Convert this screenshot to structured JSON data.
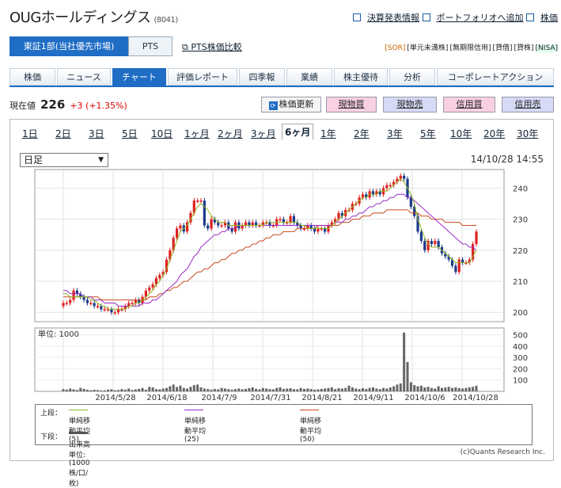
{
  "header": {
    "company": "OUGホールディングス",
    "code": "(8041)",
    "links": [
      "決算発表情報",
      "ポートフォリオへ追加",
      "株価"
    ]
  },
  "market_tabs": {
    "active": "東証1部(当社優先市場)",
    "other": "PTS",
    "compare": "PTS株価比較"
  },
  "badges": [
    "[SOR]",
    "[単元未満株]",
    "[無期限信用]",
    "[貸借]",
    "[貸株]",
    "[NISA]"
  ],
  "nav": [
    {
      "label": "株価"
    },
    {
      "label": "ニュース"
    },
    {
      "label": "チャート"
    },
    {
      "label": "評価レポート"
    },
    {
      "label": "四季報"
    },
    {
      "label": "業績"
    },
    {
      "label": "株主優待"
    },
    {
      "label": "分析"
    },
    {
      "label": "コーポレートアクション"
    }
  ],
  "price": {
    "label": "現在値",
    "value": "226",
    "change": "+3 (+1.35%)"
  },
  "actions": {
    "refresh": "株価更新",
    "buy": "現物買",
    "sell": "現物売",
    "margin_buy": "信用買",
    "margin_sell": "信用売"
  },
  "periods": [
    "1日",
    "2日",
    "3日",
    "5日",
    "10日",
    "1ヶ月",
    "2ヶ月",
    "3ヶ月",
    "6ヶ月",
    "1年",
    "2年",
    "3年",
    "5年",
    "10年",
    "20年",
    "30年"
  ],
  "period_active": "6ヶ月",
  "select": {
    "value": "日足"
  },
  "timestamp": "14/10/28 14:55",
  "legend": {
    "upper_label": "上段：",
    "lower_label": "下段：",
    "ma5": "単純移動平均(5)",
    "ma25": "単純移動平均(25)",
    "ma50": "単純移動平均(50)",
    "volume": "出来高 単位:(1000株/口/枚)"
  },
  "credit": "(c)Quants Research Inc.",
  "colors": {
    "up": "#e02020",
    "down": "#1c3a8c",
    "ma5": "#8cb820",
    "ma25": "#9a2bc4",
    "ma50": "#c84a1c",
    "accent": "#1f6dc5"
  },
  "chart_data": {
    "type": "candlestick",
    "price_axis": {
      "ticks": [
        200,
        210,
        220,
        230,
        240
      ],
      "range": [
        197,
        246
      ]
    },
    "volume_axis": {
      "label": "単位: 1000",
      "ticks": [
        100,
        200,
        300,
        400,
        500
      ],
      "range": [
        0,
        560
      ]
    },
    "x_labels": [
      "2014/5/28",
      "2014/6/18",
      "2014/7/9",
      "2014/7/31",
      "2014/8/21",
      "2014/9/11",
      "2014/10/6",
      "2014/10/28"
    ],
    "close": [
      203,
      203,
      204,
      207,
      206,
      205,
      204,
      203,
      203,
      202,
      202,
      201,
      201,
      201,
      200,
      200,
      201,
      201,
      202,
      203,
      203,
      204,
      203,
      205,
      207,
      208,
      209,
      211,
      212,
      213,
      217,
      220,
      224,
      227,
      228,
      226,
      229,
      232,
      236,
      236,
      236,
      228,
      227,
      230,
      229,
      228,
      228,
      229,
      227,
      226,
      229,
      227,
      228,
      229,
      228,
      229,
      228,
      228,
      229,
      229,
      228,
      228,
      230,
      230,
      229,
      229,
      231,
      229,
      228,
      227,
      227,
      228,
      227,
      226,
      227,
      227,
      226,
      228,
      229,
      230,
      232,
      231,
      233,
      233,
      235,
      235,
      237,
      238,
      237,
      239,
      238,
      239,
      238,
      240,
      241,
      241,
      242,
      243,
      244,
      243,
      237,
      234,
      231,
      226,
      223,
      220,
      223,
      222,
      223,
      221,
      219,
      218,
      217,
      215,
      213,
      217,
      216,
      216,
      217,
      222,
      226
    ],
    "ma5": [
      206,
      206,
      205,
      205,
      205,
      205,
      205,
      205,
      204,
      204,
      203,
      202,
      202,
      201,
      201,
      201,
      201,
      201,
      201,
      202,
      202,
      203,
      203,
      204,
      205,
      206,
      207,
      209,
      210,
      212,
      214,
      217,
      220,
      223,
      226,
      227,
      228,
      230,
      232,
      234,
      235,
      234,
      233,
      231,
      230,
      229,
      229,
      229,
      228,
      228,
      228,
      228,
      228,
      228,
      228,
      228,
      228,
      228,
      228,
      229,
      229,
      229,
      229,
      229,
      229,
      229,
      229,
      229,
      229,
      228,
      228,
      227,
      227,
      227,
      227,
      227,
      227,
      227,
      228,
      229,
      230,
      231,
      232,
      233,
      234,
      235,
      236,
      237,
      237,
      238,
      238,
      238,
      239,
      239,
      239,
      240,
      241,
      242,
      243,
      242,
      240,
      238,
      235,
      230,
      227,
      224,
      222,
      221,
      221,
      221,
      220,
      219,
      218,
      217,
      216,
      216,
      216,
      216,
      216,
      218,
      220
    ],
    "ma25": [
      207,
      207,
      206,
      206,
      206,
      206,
      205,
      205,
      205,
      204,
      204,
      204,
      203,
      203,
      203,
      203,
      202,
      202,
      202,
      202,
      202,
      202,
      202,
      203,
      203,
      203,
      204,
      204,
      205,
      206,
      207,
      208,
      209,
      210,
      212,
      213,
      214,
      216,
      218,
      219,
      221,
      222,
      223,
      224,
      225,
      225,
      226,
      226,
      227,
      227,
      227,
      228,
      228,
      228,
      228,
      228,
      228,
      228,
      228,
      228,
      228,
      228,
      228,
      228,
      228,
      228,
      228,
      228,
      228,
      228,
      228,
      228,
      228,
      228,
      228,
      228,
      228,
      228,
      228,
      229,
      229,
      229,
      230,
      230,
      231,
      231,
      232,
      232,
      233,
      234,
      234,
      235,
      235,
      236,
      236,
      237,
      237,
      238,
      238,
      238,
      237,
      237,
      236,
      235,
      234,
      233,
      232,
      231,
      230,
      229,
      228,
      227,
      226,
      225,
      224,
      223,
      222,
      222,
      221,
      221,
      220
    ],
    "ma50": [
      205,
      205,
      205,
      205,
      205,
      205,
      205,
      205,
      205,
      205,
      205,
      204,
      204,
      204,
      204,
      204,
      204,
      204,
      204,
      204,
      204,
      204,
      204,
      204,
      204,
      205,
      205,
      205,
      206,
      206,
      207,
      207,
      208,
      208,
      209,
      210,
      210,
      211,
      212,
      213,
      213,
      214,
      214,
      215,
      216,
      216,
      217,
      217,
      218,
      219,
      219,
      220,
      220,
      221,
      221,
      222,
      222,
      223,
      223,
      224,
      224,
      225,
      225,
      225,
      226,
      226,
      226,
      226,
      227,
      227,
      227,
      227,
      227,
      227,
      228,
      228,
      228,
      228,
      228,
      228,
      228,
      229,
      229,
      229,
      230,
      230,
      230,
      231,
      231,
      231,
      232,
      232,
      232,
      232,
      233,
      233,
      233,
      233,
      233,
      233,
      233,
      232,
      232,
      232,
      231,
      231,
      231,
      230,
      230,
      230,
      230,
      229,
      229,
      229,
      229,
      229,
      228,
      228,
      228,
      228,
      228
    ],
    "volume": [
      20,
      15,
      25,
      18,
      12,
      30,
      22,
      15,
      10,
      14,
      12,
      8,
      9,
      15,
      18,
      10,
      12,
      20,
      15,
      25,
      12,
      18,
      22,
      30,
      15,
      40,
      35,
      20,
      18,
      25,
      30,
      45,
      60,
      38,
      50,
      30,
      25,
      40,
      55,
      60,
      35,
      25,
      20,
      15,
      22,
      18,
      30,
      25,
      20,
      15,
      20,
      25,
      18,
      22,
      28,
      35,
      22,
      18,
      30,
      25,
      20,
      18,
      30,
      35,
      22,
      25,
      28,
      20,
      18,
      30,
      22,
      25,
      20,
      15,
      18,
      22,
      25,
      30,
      35,
      20,
      28,
      25,
      30,
      50,
      35,
      25,
      20,
      28,
      22,
      30,
      35,
      25,
      20,
      30,
      25,
      35,
      45,
      60,
      70,
      520,
      260,
      80,
      55,
      45,
      50,
      35,
      40,
      30,
      25,
      45,
      30,
      35,
      40,
      30,
      35,
      28,
      25,
      30,
      35,
      40,
      50
    ]
  }
}
